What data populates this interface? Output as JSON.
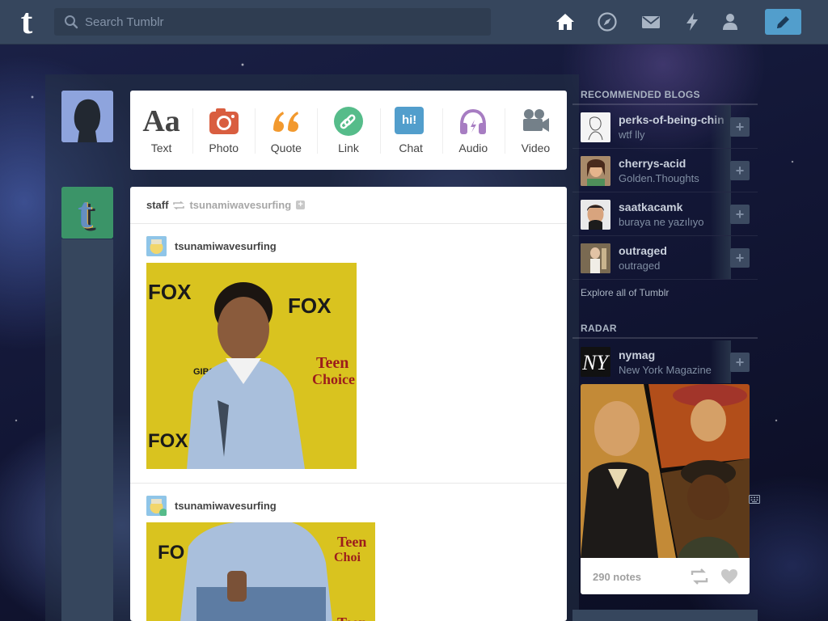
{
  "app": {
    "logo_letter": "t"
  },
  "search": {
    "placeholder": "Search Tumblr",
    "value": ""
  },
  "nav": {
    "icons": [
      "home-icon",
      "explore-compass-icon",
      "messages-mail-icon",
      "activity-lightning-icon",
      "account-person-icon"
    ],
    "compose_icon": "pencil-icon",
    "colors": {
      "topbar": "#36465d",
      "compose": "#529ecc",
      "active": "#ffffff",
      "inactive": "#a8b4c4"
    }
  },
  "composer": {
    "types": [
      {
        "label": "Text",
        "icon": "text-aa-icon",
        "color": "#444444",
        "glyph": "Aa"
      },
      {
        "label": "Photo",
        "icon": "camera-icon",
        "color": "#d95e40"
      },
      {
        "label": "Quote",
        "icon": "quote-icon",
        "color": "#f2992e"
      },
      {
        "label": "Link",
        "icon": "link-icon",
        "color": "#56bc8a"
      },
      {
        "label": "Chat",
        "icon": "chat-icon",
        "color": "#529ecc",
        "glyph": "hi!"
      },
      {
        "label": "Audio",
        "icon": "headphones-icon",
        "color": "#a77dc2"
      },
      {
        "label": "Video",
        "icon": "video-camera-icon",
        "color": "#748089"
      }
    ]
  },
  "post": {
    "poster": "staff",
    "reblogged_from": "tsunamiwavesurfing",
    "trail": [
      {
        "username": "tsunamiwavesurfing"
      },
      {
        "username": "tsunamiwavesurfing"
      }
    ]
  },
  "sidebar": {
    "recommended_title": "RECOMMENDED BLOGS",
    "recommended": [
      {
        "name": "perks-of-being-chin",
        "desc": "wtf lly"
      },
      {
        "name": "cherrys-acid",
        "desc": "Golden.Thoughts"
      },
      {
        "name": "saatkacamk",
        "desc": "buraya ne yazılıyo"
      },
      {
        "name": "outraged",
        "desc": "outraged"
      }
    ],
    "explore_label": "Explore all of Tumblr",
    "radar_title": "RADAR",
    "radar": {
      "name": "nymag",
      "desc": "New York Magazine",
      "avatar_text": "NY",
      "notes": "290 notes"
    }
  }
}
